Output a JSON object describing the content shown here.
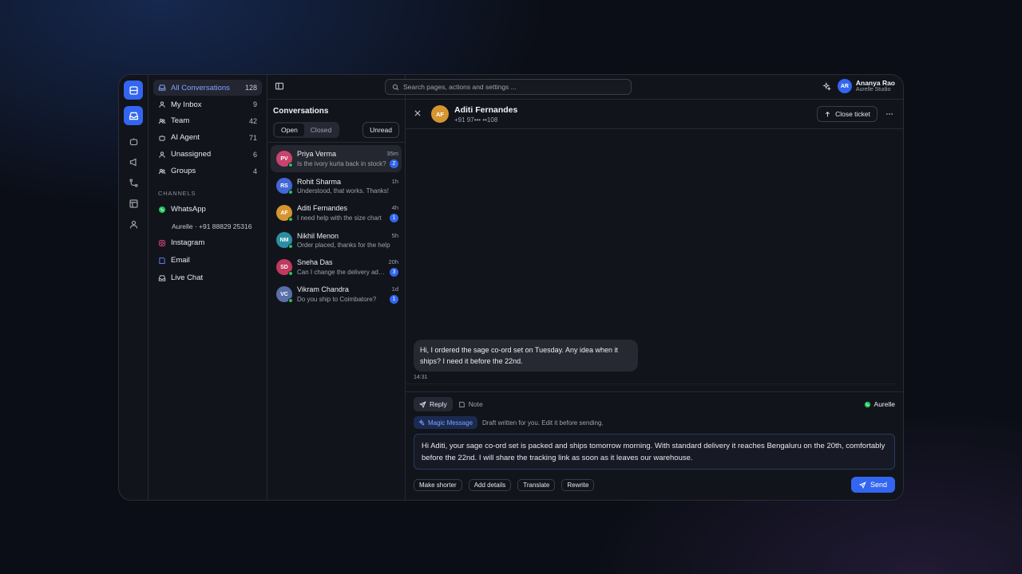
{
  "nav": {
    "items": [
      {
        "label": "All Conversations",
        "count": "128",
        "icon": "inbox-icon"
      },
      {
        "label": "My Inbox",
        "count": "9",
        "icon": "user-icon"
      },
      {
        "label": "Team",
        "count": "42",
        "icon": "users-icon"
      },
      {
        "label": "AI Agent",
        "count": "71",
        "icon": "bot-icon"
      },
      {
        "label": "Unassigned",
        "count": "6",
        "icon": "user-icon"
      },
      {
        "label": "Groups",
        "count": "4",
        "icon": "users-icon"
      }
    ],
    "channels_label": "CHANNELS",
    "channels": [
      {
        "label": "WhatsApp",
        "icon": "whatsapp-icon",
        "color": "#22c55e"
      },
      {
        "label": "Aurelle · +91 88829 25316"
      },
      {
        "label": "Instagram",
        "icon": "instagram-icon",
        "color": "#e0457b"
      },
      {
        "label": "Email",
        "icon": "email-icon",
        "color": "#5b7cf0"
      },
      {
        "label": "Live Chat",
        "icon": "chat-icon"
      }
    ]
  },
  "conversations": {
    "title": "Conversations",
    "tabs": [
      "Open",
      "Closed"
    ],
    "unread_label": "Unread",
    "items": [
      {
        "initials": "PV",
        "name": "Priya Verma",
        "time": "35m",
        "preview": "Is the ivory kurta back in stock?",
        "badge": "2",
        "color": "#c9436e"
      },
      {
        "initials": "RS",
        "name": "Rohit Sharma",
        "time": "1h",
        "preview": "Understood, that works. Thanks!",
        "badge": "",
        "color": "#4168d6"
      },
      {
        "initials": "AF",
        "name": "Aditi Fernandes",
        "time": "4h",
        "preview": "I need help with the size chart",
        "badge": "1",
        "color": "#d59531"
      },
      {
        "initials": "NM",
        "name": "Nikhil Menon",
        "time": "5h",
        "preview": "Order placed, thanks for the help",
        "badge": "",
        "color": "#2a8fa3"
      },
      {
        "initials": "SD",
        "name": "Sneha Das",
        "time": "20h",
        "preview": "Can I change the delivery address?",
        "badge": "3",
        "color": "#c1395f"
      },
      {
        "initials": "VC",
        "name": "Vikram Chandra",
        "time": "1d",
        "preview": "Do you ship to Coimbatore?",
        "badge": "1",
        "color": "#5a6fa8"
      }
    ]
  },
  "topbar": {
    "search_placeholder": "Search pages, actions and settings ...",
    "user_initials": "AR",
    "user_name": "Ananya Rao",
    "user_org": "Aurelle Studio"
  },
  "chat": {
    "contact_initials": "AF",
    "contact_name": "Aditi Fernandes",
    "contact_phone": "+91 97••• ••108",
    "close_ticket_label": "Close ticket",
    "message": "Hi, I ordered the sage co-ord set on Tuesday. Any idea when it ships? I need it before the 22nd.",
    "message_time": "14:31"
  },
  "composer": {
    "reply_label": "Reply",
    "note_label": "Note",
    "channel_label": "Aurelle",
    "magic_label": "Magic Message",
    "magic_note": "Draft written for you. Edit it before sending.",
    "draft": "Hi Aditi, your sage co-ord set is packed and ships tomorrow morning. With standard delivery it reaches Bengaluru on the 20th, comfortably before the 22nd. I will share the tracking link as soon as it leaves our warehouse.",
    "actions": [
      "Make shorter",
      "Add details",
      "Translate",
      "Rewrite"
    ],
    "send_label": "Send"
  },
  "colors": {
    "accent": "#3366f0",
    "online": "#22c55e"
  }
}
